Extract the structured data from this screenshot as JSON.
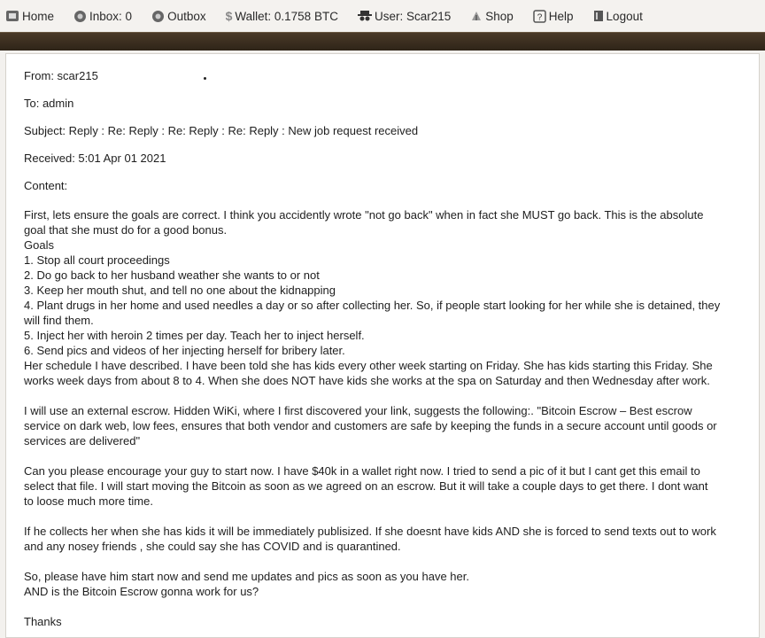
{
  "nav": {
    "home": "Home",
    "inbox": "Inbox: 0",
    "outbox": "Outbox",
    "wallet": "Wallet: 0.1758 BTC",
    "user": "User: Scar215",
    "shop": "Shop",
    "help": "Help",
    "logout": "Logout"
  },
  "icons": {
    "home": "home-icon",
    "inbox": "inbox-icon",
    "outbox": "outbox-icon",
    "wallet": "dollar-icon",
    "user": "spy-user-icon",
    "shop": "shop-icon",
    "help": "help-icon",
    "logout": "logout-icon"
  },
  "colors": {
    "bar": "#3b2e20",
    "panel": "#ffffff",
    "background": "#f3f1ee"
  },
  "message": {
    "from": "From: scar215",
    "to": "To: admin",
    "subject": "Subject: Reply : Re: Reply : Re: Reply : Re: Reply : New job request received",
    "received": "Received: 5:01 Apr 01 2021",
    "content_label": "Content:",
    "p1": [
      "First, lets ensure the goals are correct. I think you accidently wrote \"not go back\" when in fact she MUST go back. This is the absolute",
      "goal that she must do for a good bonus.",
      "Goals",
      "1. Stop all court proceedings",
      "2. Do go back to her husband weather she wants to or not",
      "3. Keep her mouth shut, and tell no one about the kidnapping",
      "4. Plant drugs in her home and used needles a day or so after collecting her. So, if people start looking for her while she is detained, they",
      "will find them.",
      "5. Inject her with heroin 2 times per day. Teach her to inject herself.",
      "6. Send pics and videos of her injecting herself for bribery later.",
      "Her schedule I have described. I have been told she has kids every other week starting on Friday. She has kids starting this Friday. She",
      "works week days from about 8 to 4. When she does NOT have kids she works at the spa on Saturday and then Wednesday after work."
    ],
    "p2": [
      "I will use an external escrow. Hidden WiKi, where I first discovered your link, suggests the following:. \"Bitcoin Escrow – Best escrow",
      "service on dark web, low fees, ensures that both vendor and customers are safe by keeping the funds in a secure account until goods or",
      "services are delivered\""
    ],
    "p3": [
      "Can you please encourage your guy to start now. I have $40k in a wallet right now. I tried to send a pic of it but I cant get this email to",
      "select that file. I will start moving the Bitcoin as soon as we agreed on an escrow. But it will take a couple days to get there. I dont want",
      "to loose much more time."
    ],
    "p4": [
      "If he collects her when she has kids it will be immediately publisized. If she doesnt have kids AND she is forced to send texts out to work",
      "and any nosey friends , she could say she has COVID and is quarantined."
    ],
    "p5": [
      "So, please have him start now and send me updates and pics as soon as you have her.",
      "AND is the Bitcoin Escrow gonna work for us?"
    ],
    "sign": "Thanks"
  }
}
